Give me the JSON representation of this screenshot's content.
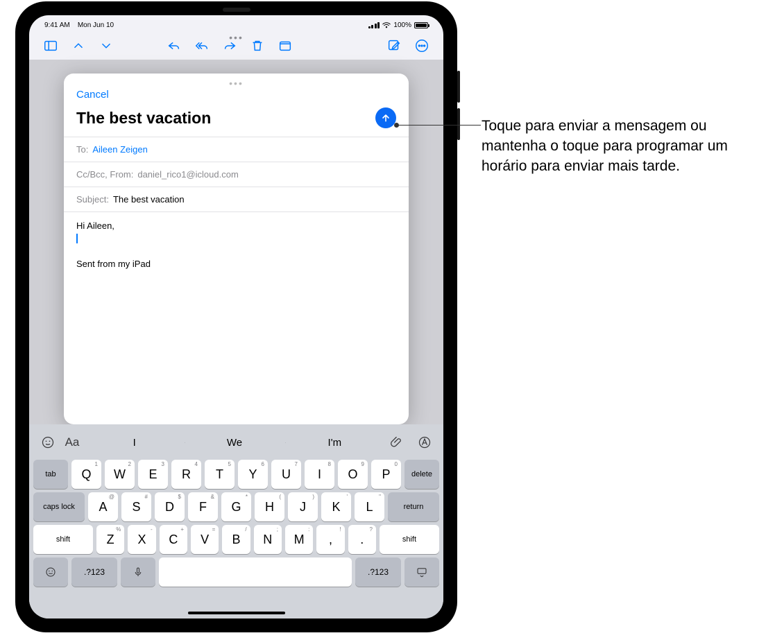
{
  "status": {
    "time": "9:41 AM",
    "date": "Mon Jun 10",
    "battery": "100%"
  },
  "compose": {
    "cancel": "Cancel",
    "title": "The best vacation",
    "to_label": "To:",
    "to_value": "Aileen Zeigen",
    "ccbcc_label": "Cc/Bcc, From:",
    "ccbcc_value": "daniel_rico1@icloud.com",
    "subject_label": "Subject:",
    "subject_value": "The best vacation",
    "body_greeting": "Hi Aileen,",
    "body_signature": "Sent from my iPad"
  },
  "keyboard": {
    "suggestions": [
      "I",
      "We",
      "I'm"
    ],
    "row1": [
      {
        "main": "Q",
        "sub": "1"
      },
      {
        "main": "W",
        "sub": "2"
      },
      {
        "main": "E",
        "sub": "3"
      },
      {
        "main": "R",
        "sub": "4"
      },
      {
        "main": "T",
        "sub": "5"
      },
      {
        "main": "Y",
        "sub": "6"
      },
      {
        "main": "U",
        "sub": "7"
      },
      {
        "main": "I",
        "sub": "8"
      },
      {
        "main": "O",
        "sub": "9"
      },
      {
        "main": "P",
        "sub": "0"
      }
    ],
    "row2": [
      {
        "main": "A",
        "sub": "@"
      },
      {
        "main": "S",
        "sub": "#"
      },
      {
        "main": "D",
        "sub": "$"
      },
      {
        "main": "F",
        "sub": "&"
      },
      {
        "main": "G",
        "sub": "*"
      },
      {
        "main": "H",
        "sub": "("
      },
      {
        "main": "J",
        "sub": ")"
      },
      {
        "main": "K",
        "sub": "'"
      },
      {
        "main": "L",
        "sub": "\""
      }
    ],
    "row3": [
      {
        "main": "Z",
        "sub": "%"
      },
      {
        "main": "X",
        "sub": "-"
      },
      {
        "main": "C",
        "sub": "+"
      },
      {
        "main": "V",
        "sub": "="
      },
      {
        "main": "B",
        "sub": "/"
      },
      {
        "main": "N",
        "sub": ";"
      },
      {
        "main": "M",
        "sub": ":"
      },
      {
        "main": ",",
        "sub": "!"
      },
      {
        "main": ".",
        "sub": "?"
      }
    ],
    "tab": "tab",
    "delete": "delete",
    "caps": "caps lock",
    "return": "return",
    "shift": "shift",
    "numsym": ".?123"
  },
  "callout": {
    "text": "Toque para enviar a mensagem ou mantenha o toque para programar um horário para enviar mais tarde."
  }
}
